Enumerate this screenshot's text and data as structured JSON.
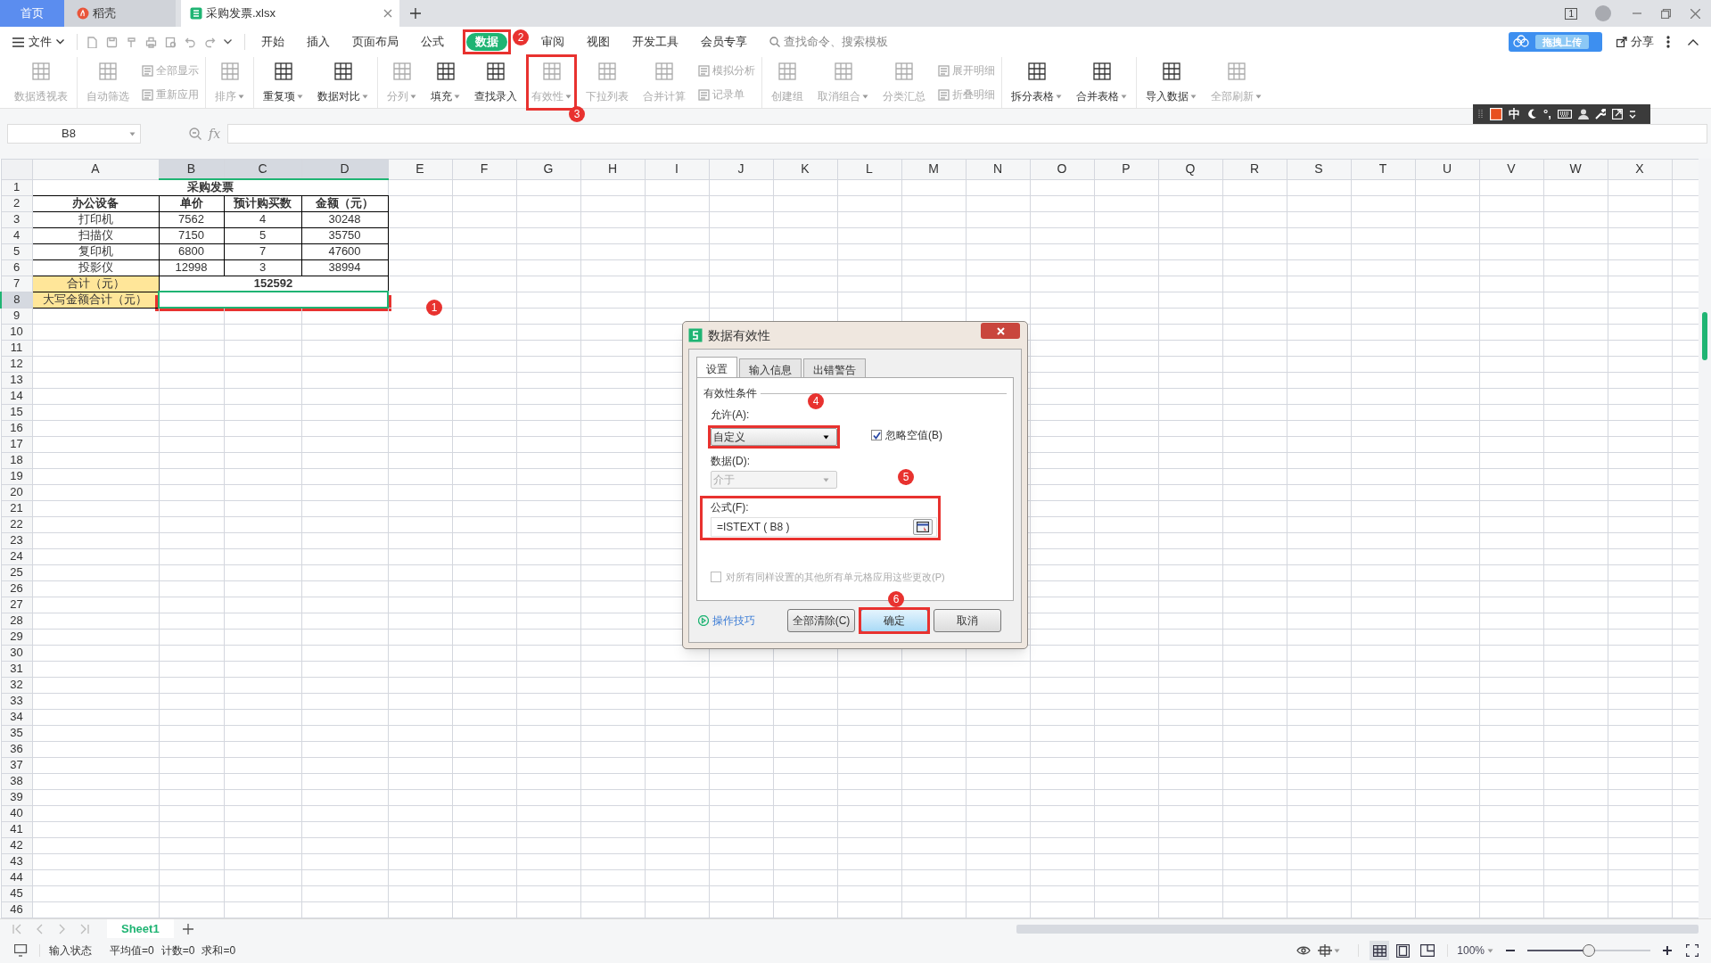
{
  "tabs": [
    {
      "label": "首页",
      "kind": "home",
      "selected": false
    },
    {
      "label": "稻壳",
      "kind": "docer",
      "selected": false
    },
    {
      "label": "采购发票.xlsx",
      "kind": "file",
      "selected": true
    }
  ],
  "window_count": "1",
  "menu": {
    "file": "文件",
    "tabs": [
      {
        "label": "开始",
        "selected": false
      },
      {
        "label": "插入",
        "selected": false
      },
      {
        "label": "页面布局",
        "selected": false
      },
      {
        "label": "公式",
        "selected": false
      },
      {
        "label": "数据",
        "selected": true
      },
      {
        "label": "审阅",
        "selected": false
      },
      {
        "label": "视图",
        "selected": false
      },
      {
        "label": "开发工具",
        "selected": false
      },
      {
        "label": "会员专享",
        "selected": false
      }
    ],
    "search": {
      "placeholder": "查找命令、搜索模板"
    },
    "upload_popup": "拖拽上传",
    "share": "分享"
  },
  "ribbon": {
    "groups": [
      [
        {
          "kind": "large",
          "label": "数据透视表",
          "disabled": true,
          "dropdown": false
        }
      ],
      [
        {
          "kind": "large",
          "label": "自动筛选",
          "disabled": true,
          "dropdown": false
        },
        {
          "kind": "stack",
          "items": [
            {
              "label": "全部显示",
              "disabled": true
            },
            {
              "label": "重新应用",
              "disabled": true
            }
          ]
        }
      ],
      [
        {
          "kind": "large",
          "label": "排序",
          "disabled": true,
          "dropdown": true
        }
      ],
      [
        {
          "kind": "large",
          "label": "重复项",
          "disabled": false,
          "dropdown": true
        },
        {
          "kind": "large",
          "label": "数据对比",
          "disabled": false,
          "dropdown": true
        }
      ],
      [
        {
          "kind": "large",
          "label": "分列",
          "disabled": true,
          "dropdown": true
        },
        {
          "kind": "large",
          "label": "填充",
          "disabled": false,
          "dropdown": true
        },
        {
          "kind": "large",
          "label": "查找录入",
          "disabled": false,
          "dropdown": false
        },
        {
          "kind": "large",
          "label": "有效性",
          "disabled": true,
          "dropdown": true
        },
        {
          "kind": "large",
          "label": "下拉列表",
          "disabled": true,
          "dropdown": false
        },
        {
          "kind": "large",
          "label": "合并计算",
          "disabled": true,
          "dropdown": false
        },
        {
          "kind": "stack",
          "items": [
            {
              "label": "模拟分析",
              "disabled": true
            },
            {
              "label": "记录单",
              "disabled": true
            }
          ]
        }
      ],
      [
        {
          "kind": "large",
          "label": "创建组",
          "disabled": true,
          "dropdown": false
        },
        {
          "kind": "large",
          "label": "取消组合",
          "disabled": true,
          "dropdown": true
        },
        {
          "kind": "large",
          "label": "分类汇总",
          "disabled": true,
          "dropdown": false
        },
        {
          "kind": "stack",
          "items": [
            {
              "label": "展开明细",
              "disabled": true
            },
            {
              "label": "折叠明细",
              "disabled": true
            }
          ]
        }
      ],
      [
        {
          "kind": "large",
          "label": "拆分表格",
          "disabled": false,
          "dropdown": true
        },
        {
          "kind": "large",
          "label": "合并表格",
          "disabled": false,
          "dropdown": true
        }
      ],
      [
        {
          "kind": "large",
          "label": "导入数据",
          "disabled": false,
          "dropdown": true
        },
        {
          "kind": "large",
          "label": "全部刷新",
          "disabled": true,
          "dropdown": true
        }
      ]
    ]
  },
  "ime": {
    "mode": "中",
    "punct": "°,"
  },
  "formula_bar": {
    "name_box": "B8",
    "fx": "fx"
  },
  "sheet": {
    "columns": [
      {
        "label": "A",
        "selected": false
      },
      {
        "label": "B",
        "selected": true
      },
      {
        "label": "C",
        "selected": true
      },
      {
        "label": "D",
        "selected": true
      },
      {
        "label": "E",
        "selected": false
      },
      {
        "label": "F",
        "selected": false
      },
      {
        "label": "G",
        "selected": false
      },
      {
        "label": "H",
        "selected": false
      },
      {
        "label": "I",
        "selected": false
      },
      {
        "label": "J",
        "selected": false
      },
      {
        "label": "K",
        "selected": false
      },
      {
        "label": "L",
        "selected": false
      },
      {
        "label": "M",
        "selected": false
      },
      {
        "label": "N",
        "selected": false
      },
      {
        "label": "O",
        "selected": false
      },
      {
        "label": "P",
        "selected": false
      },
      {
        "label": "Q",
        "selected": false
      },
      {
        "label": "R",
        "selected": false
      },
      {
        "label": "S",
        "selected": false
      },
      {
        "label": "T",
        "selected": false
      },
      {
        "label": "U",
        "selected": false
      },
      {
        "label": "V",
        "selected": false
      },
      {
        "label": "W",
        "selected": false
      },
      {
        "label": "X",
        "selected": false
      }
    ],
    "rows": [
      {
        "number": "1",
        "selected": false
      },
      {
        "number": "2",
        "selected": false
      },
      {
        "number": "3",
        "selected": false
      },
      {
        "number": "4",
        "selected": false
      },
      {
        "number": "5",
        "selected": false
      },
      {
        "number": "6",
        "selected": false
      },
      {
        "number": "7",
        "selected": false
      },
      {
        "number": "8",
        "selected": true
      },
      {
        "number": "9",
        "selected": false
      },
      {
        "number": "10",
        "selected": false
      },
      {
        "number": "11",
        "selected": false
      },
      {
        "number": "12",
        "selected": false
      },
      {
        "number": "13",
        "selected": false
      },
      {
        "number": "14",
        "selected": false
      },
      {
        "number": "15",
        "selected": false
      },
      {
        "number": "16",
        "selected": false
      },
      {
        "number": "17",
        "selected": false
      },
      {
        "number": "18",
        "selected": false
      },
      {
        "number": "19",
        "selected": false
      },
      {
        "number": "20",
        "selected": false
      },
      {
        "number": "21",
        "selected": false
      },
      {
        "number": "22",
        "selected": false
      },
      {
        "number": "23",
        "selected": false
      },
      {
        "number": "24",
        "selected": false
      },
      {
        "number": "25",
        "selected": false
      },
      {
        "number": "26",
        "selected": false
      },
      {
        "number": "27",
        "selected": false
      },
      {
        "number": "28",
        "selected": false
      },
      {
        "number": "29",
        "selected": false
      },
      {
        "number": "30",
        "selected": false
      },
      {
        "number": "31",
        "selected": false
      },
      {
        "number": "32",
        "selected": false
      },
      {
        "number": "33",
        "selected": false
      },
      {
        "number": "34",
        "selected": false
      },
      {
        "number": "35",
        "selected": false
      },
      {
        "number": "36",
        "selected": false
      },
      {
        "number": "37",
        "selected": false
      },
      {
        "number": "38",
        "selected": false
      },
      {
        "number": "39",
        "selected": false
      },
      {
        "number": "40",
        "selected": false
      },
      {
        "number": "41",
        "selected": false
      },
      {
        "number": "42",
        "selected": false
      },
      {
        "number": "43",
        "selected": false
      },
      {
        "number": "44",
        "selected": false
      },
      {
        "number": "45",
        "selected": false
      },
      {
        "number": "46",
        "selected": false
      }
    ],
    "title": "采购发票",
    "header": [
      "办公设备",
      "单价",
      "预计购买数",
      "金额（元）"
    ],
    "data": [
      [
        "打印机",
        "7562",
        "4",
        "30248"
      ],
      [
        "扫描仪",
        "7150",
        "5",
        "35750"
      ],
      [
        "复印机",
        "6800",
        "7",
        "47600"
      ],
      [
        "投影仪",
        "12998",
        "3",
        "38994"
      ]
    ],
    "total_label": "合计（元）",
    "total_value": "152592",
    "uppercase_label": "大写金额合计（元）"
  },
  "dialog": {
    "title": "数据有效性",
    "tabs": [
      {
        "label": "设置",
        "selected": true
      },
      {
        "label": "输入信息",
        "selected": false
      },
      {
        "label": "出错警告",
        "selected": false
      }
    ],
    "group_title": "有效性条件",
    "allow_label": "允许(A):",
    "allow_value": "自定义",
    "ignore_blank": {
      "label": "忽略空值(B)",
      "checked": true
    },
    "data_label": "数据(D):",
    "data_value": "介于",
    "data_disabled": true,
    "formula_label": "公式(F):",
    "formula_value": "=ISTEXT ( B8 )",
    "apply_all": {
      "label": "对所有同样设置的其他所有单元格应用这些更改(P)",
      "checked": false,
      "disabled": true
    },
    "tips_link": "操作技巧",
    "buttons": [
      {
        "label": "全部清除(C)",
        "kind": "normal"
      },
      {
        "label": "确定",
        "kind": "default"
      },
      {
        "label": "取消",
        "kind": "normal"
      }
    ]
  },
  "annotations": [
    "1",
    "2",
    "3",
    "4",
    "5",
    "6"
  ],
  "sheet_tabs": [
    {
      "label": "Sheet1",
      "selected": true
    }
  ],
  "status_bar": {
    "mode": "输入状态",
    "average": "平均值=0",
    "count": "计数=0",
    "sum": "求和=0",
    "zoom": "100%",
    "zoom_slider": {
      "level": 0.5
    }
  }
}
